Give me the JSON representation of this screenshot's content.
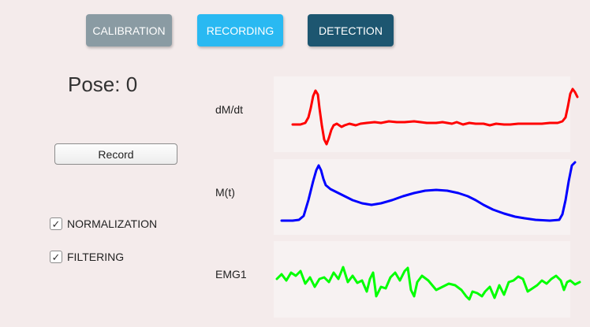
{
  "tabs": {
    "calibration": "CALIBRATION",
    "recording": "RECORDING",
    "detection": "DETECTION"
  },
  "pose": {
    "text": "Pose: 0"
  },
  "record_button": {
    "label": "Record"
  },
  "options": {
    "normalization": {
      "label": "NORMALIZATION",
      "checked": true
    },
    "filtering": {
      "label": "FILTERING",
      "checked": true
    }
  },
  "check_glyph": "✓",
  "plots": {
    "dmdt": {
      "label": "dM/dt",
      "color": "#ff0000"
    },
    "mt": {
      "label": "M(t)",
      "color": "#0000ff"
    },
    "emg1": {
      "label": "EMG1",
      "color": "#00ff00"
    }
  }
}
